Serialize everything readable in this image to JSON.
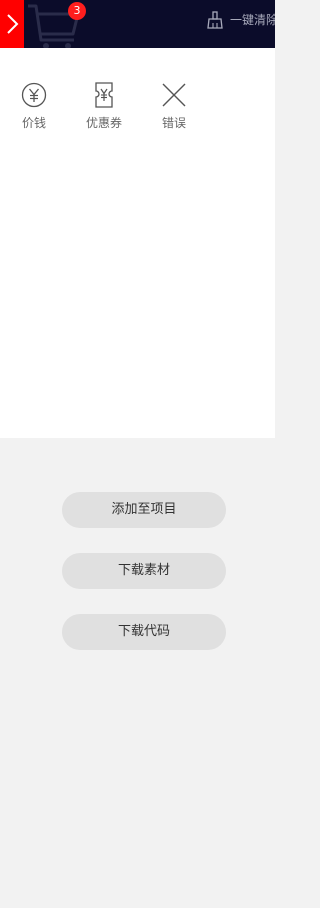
{
  "topbar": {
    "cart_count": "3",
    "clear_label": "一键清除"
  },
  "tools": [
    {
      "label": "价钱",
      "icon": "yen-circle-icon"
    },
    {
      "label": "优惠券",
      "icon": "coupon-icon"
    },
    {
      "label": "错误",
      "icon": "close-x-icon"
    }
  ],
  "actions": {
    "add_to_project": "添加至项目",
    "download_assets": "下载素材",
    "download_code": "下载代码"
  },
  "colors": {
    "topbar_bg": "#0b0c2a",
    "toggle_bg": "#ff0000",
    "badge_bg": "#ff1e1e",
    "button_bg": "#e0e0e0",
    "page_bg": "#f2f2f2"
  }
}
